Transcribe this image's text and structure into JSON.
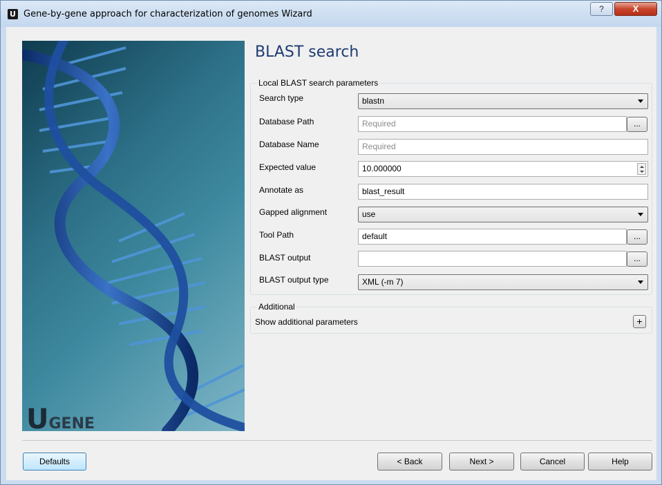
{
  "window": {
    "title": "Gene-by-gene approach for characterization of genomes Wizard",
    "app_icon_letter": "U",
    "help_glyph": "?",
    "close_glyph": "X"
  },
  "side_image": {
    "logo_u": "U",
    "logo_gene": "GENE"
  },
  "page": {
    "title": "BLAST search"
  },
  "local_params": {
    "group_title": "Local BLAST search parameters",
    "search_type": {
      "label": "Search type",
      "value": "blastn"
    },
    "database_path": {
      "label": "Database Path",
      "placeholder": "Required",
      "browse": "..."
    },
    "database_name": {
      "label": "Database Name",
      "placeholder": "Required"
    },
    "expected_value": {
      "label": "Expected value",
      "value": "10.000000"
    },
    "annotate_as": {
      "label": "Annotate as",
      "value": "blast_result"
    },
    "gapped_alignment": {
      "label": "Gapped alignment",
      "value": "use"
    },
    "tool_path": {
      "label": "Tool Path",
      "value": "default",
      "browse": "..."
    },
    "blast_output": {
      "label": "BLAST output",
      "value": "",
      "browse": "..."
    },
    "blast_output_type": {
      "label": "BLAST output type",
      "value": "XML (-m 7)"
    }
  },
  "additional": {
    "group_title": "Additional",
    "show_label": "Show additional parameters",
    "expand_glyph": "+"
  },
  "buttons": {
    "defaults": "Defaults",
    "back": "< Back",
    "next": "Next >",
    "cancel": "Cancel",
    "help": "Help"
  }
}
